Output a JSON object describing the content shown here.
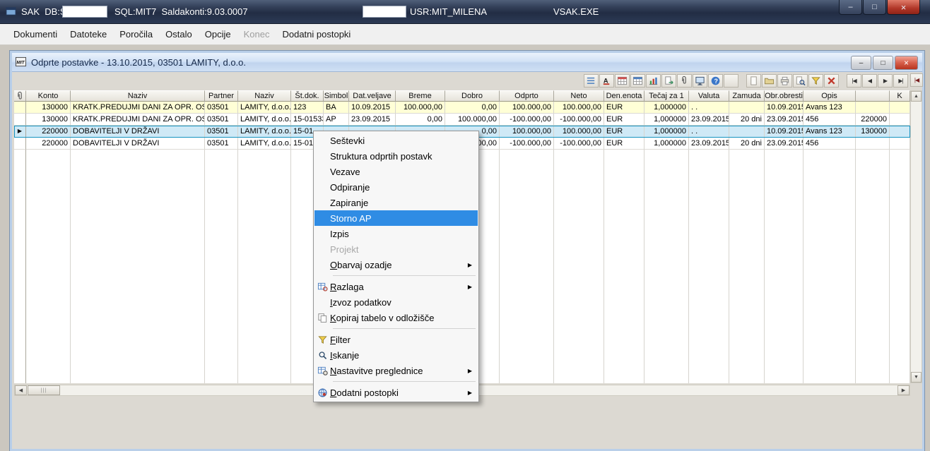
{
  "titlebar": {
    "app_label": "SAK  DB:S",
    "db_field_value": "",
    "sql_label": "SQL:MIT7  Saldakonti:9.03.0007",
    "user_field_value": "",
    "user_label": "USR:MIT_MILENA",
    "exe_label": "VSAK.EXE",
    "minimize_glyph": "–",
    "maximize_glyph": "□",
    "close_glyph": "×"
  },
  "menubar": {
    "items": [
      {
        "label": "Dokumenti",
        "enabled": true
      },
      {
        "label": "Datoteke",
        "enabled": true
      },
      {
        "label": "Poročila",
        "enabled": true
      },
      {
        "label": "Ostalo",
        "enabled": true
      },
      {
        "label": "Opcije",
        "enabled": true
      },
      {
        "label": "Konec",
        "enabled": false
      },
      {
        "label": "Dodatni postopki",
        "enabled": true
      }
    ]
  },
  "child_window": {
    "title": "Odprte postavke - 13.10.2015,  03501 LAMITY, d.o.o.",
    "minimize_glyph": "–",
    "restore_glyph": "□",
    "close_glyph": "×"
  },
  "toolbar": {
    "buttons": [
      {
        "name": "list-view",
        "icon": "list-view"
      },
      {
        "name": "font-style",
        "icon": "font-style"
      },
      {
        "name": "table-colors",
        "icon": "table-colors"
      },
      {
        "name": "table-view",
        "icon": "table-view"
      },
      {
        "name": "chart-view",
        "icon": "chart-view"
      },
      {
        "name": "export-document",
        "icon": "export-doc"
      },
      {
        "name": "attachments",
        "icon": "paperclip"
      },
      {
        "name": "screen-view",
        "icon": "screen-view"
      },
      {
        "name": "help",
        "icon": "help"
      },
      {
        "name": "blank",
        "icon": "blank"
      },
      {
        "name": "new-document",
        "icon": "new-doc"
      },
      {
        "name": "open-folder",
        "icon": "open-folder"
      },
      {
        "name": "print",
        "icon": "print"
      },
      {
        "name": "print-preview",
        "icon": "print-preview"
      },
      {
        "name": "filter",
        "icon": "filter"
      },
      {
        "name": "close-grid",
        "icon": "close-x"
      }
    ],
    "nav_buttons": [
      {
        "name": "nav-first",
        "glyph": "|◀"
      },
      {
        "name": "nav-prev",
        "glyph": "◀"
      },
      {
        "name": "nav-next",
        "glyph": "▶"
      },
      {
        "name": "nav-last",
        "glyph": "▶|"
      }
    ],
    "edge_button": {
      "name": "nav-edge",
      "glyph": "|◀"
    }
  },
  "grid": {
    "gutter_header_icon": "paperclip",
    "columns": [
      {
        "label": "Konto",
        "width": 63,
        "align": "right"
      },
      {
        "label": "Naziv",
        "width": 190,
        "align": "left"
      },
      {
        "label": "Partner",
        "width": 47,
        "align": "left"
      },
      {
        "label": "Naziv",
        "width": 75,
        "align": "left"
      },
      {
        "label": "Št.dok.",
        "width": 46,
        "align": "left"
      },
      {
        "label": "Simbol",
        "width": 36,
        "align": "left"
      },
      {
        "label": "Dat.veljave",
        "width": 66,
        "align": "left"
      },
      {
        "label": "Breme",
        "width": 70,
        "align": "right"
      },
      {
        "label": "Dobro",
        "width": 77,
        "align": "right"
      },
      {
        "label": "Odprto",
        "width": 77,
        "align": "right"
      },
      {
        "label": "Neto",
        "width": 71,
        "align": "right"
      },
      {
        "label": "Den.enota",
        "width": 57,
        "align": "left"
      },
      {
        "label": "Tečaj za 1",
        "width": 63,
        "align": "right"
      },
      {
        "label": "Valuta",
        "width": 57,
        "align": "left"
      },
      {
        "label": "Zamuda",
        "width": 50,
        "align": "right"
      },
      {
        "label": "Obr.obresti",
        "width": 55,
        "align": "left"
      },
      {
        "label": "Opis",
        "width": 74,
        "align": "left"
      },
      {
        "label": "",
        "width": 48,
        "align": "right"
      },
      {
        "label": "K",
        "width": 29,
        "align": "left"
      }
    ],
    "rows": [
      {
        "style": "yellow",
        "marker": "",
        "cells": [
          "130000",
          "KRATK.PREDUJMI DANI ZA OPR. OS",
          "03501",
          "LAMITY, d.o.o.",
          "123",
          "BA",
          "10.09.2015",
          "100.000,00",
          "0,00",
          "100.000,00",
          "100.000,00",
          "EUR",
          "1,000000",
          ". .",
          "",
          "10.09.2015",
          "Avans 123",
          "",
          ""
        ]
      },
      {
        "style": "",
        "marker": "",
        "cells": [
          "130000",
          "KRATK.PREDUJMI DANI ZA OPR. OS",
          "03501",
          "LAMITY, d.o.o.",
          "15-01533",
          "AP",
          "23.09.2015",
          "0,00",
          "100.000,00",
          "-100.000,00",
          "-100.000,00",
          "EUR",
          "1,000000",
          "23.09.2015",
          "20 dni",
          "23.09.2015",
          "456",
          "220000",
          ""
        ]
      },
      {
        "style": "selected",
        "marker": "▶",
        "cells": [
          "220000",
          "DOBAVITELJI V DRŽAVI",
          "03501",
          "LAMITY, d.o.o.",
          "15-01",
          "",
          "",
          "",
          "0,00",
          "100.000,00",
          "100.000,00",
          "EUR",
          "1,000000",
          ". .",
          "",
          "10.09.2015",
          "Avans 123",
          "130000",
          ""
        ]
      },
      {
        "style": "",
        "marker": "",
        "cells": [
          "220000",
          "DOBAVITELJI V DRŽAVI",
          "03501",
          "LAMITY, d.o.o.",
          "15-01",
          "",
          "",
          "",
          "100.000,00",
          "-100.000,00",
          "-100.000,00",
          "EUR",
          "1,000000",
          "23.09.2015",
          "20 dni",
          "23.09.2015",
          "456",
          "",
          ""
        ]
      }
    ],
    "empty_rows": 22
  },
  "context_menu": {
    "submenu_arrow": "▶",
    "items": [
      {
        "label": "Seštevki"
      },
      {
        "label": "Struktura odprtih postavk"
      },
      {
        "label": "Vezave"
      },
      {
        "label": "Odpiranje"
      },
      {
        "label": "Zapiranje"
      },
      {
        "label": "Storno AP",
        "highlighted": true
      },
      {
        "label": "Izpis"
      },
      {
        "label": "Projekt",
        "disabled": true
      },
      {
        "label": "Obarvaj ozadje",
        "underline": 0,
        "submenu": true
      },
      {
        "separator": true
      },
      {
        "label": "Razlaga",
        "underline": 0,
        "submenu": true,
        "icon": "explain"
      },
      {
        "label": "Izvoz podatkov",
        "underline": 0
      },
      {
        "label": "Kopiraj tabelo v odložišče",
        "underline": 0,
        "icon": "copy-table"
      },
      {
        "separator": true
      },
      {
        "label": "Filter",
        "underline": 0,
        "icon": "filter"
      },
      {
        "label": "Iskanje",
        "underline": 0,
        "icon": "search"
      },
      {
        "label": "Nastavitve preglednice",
        "underline": 0,
        "submenu": true,
        "icon": "table-settings"
      },
      {
        "separator": true
      },
      {
        "label": "Dodatni postopki",
        "underline": 0,
        "submenu": true,
        "icon": "extra"
      }
    ]
  },
  "scrollbars": {
    "h": {
      "left": "◀",
      "right": "▶",
      "grip": "|||"
    },
    "v": {
      "up": "▲",
      "down": "▼"
    }
  },
  "colors": {
    "menu_highlight": "#2f8ce4",
    "selected_row_border": "#1693c0",
    "row_yellow": "#ffffd6",
    "row_selected": "#cfe9f6"
  }
}
